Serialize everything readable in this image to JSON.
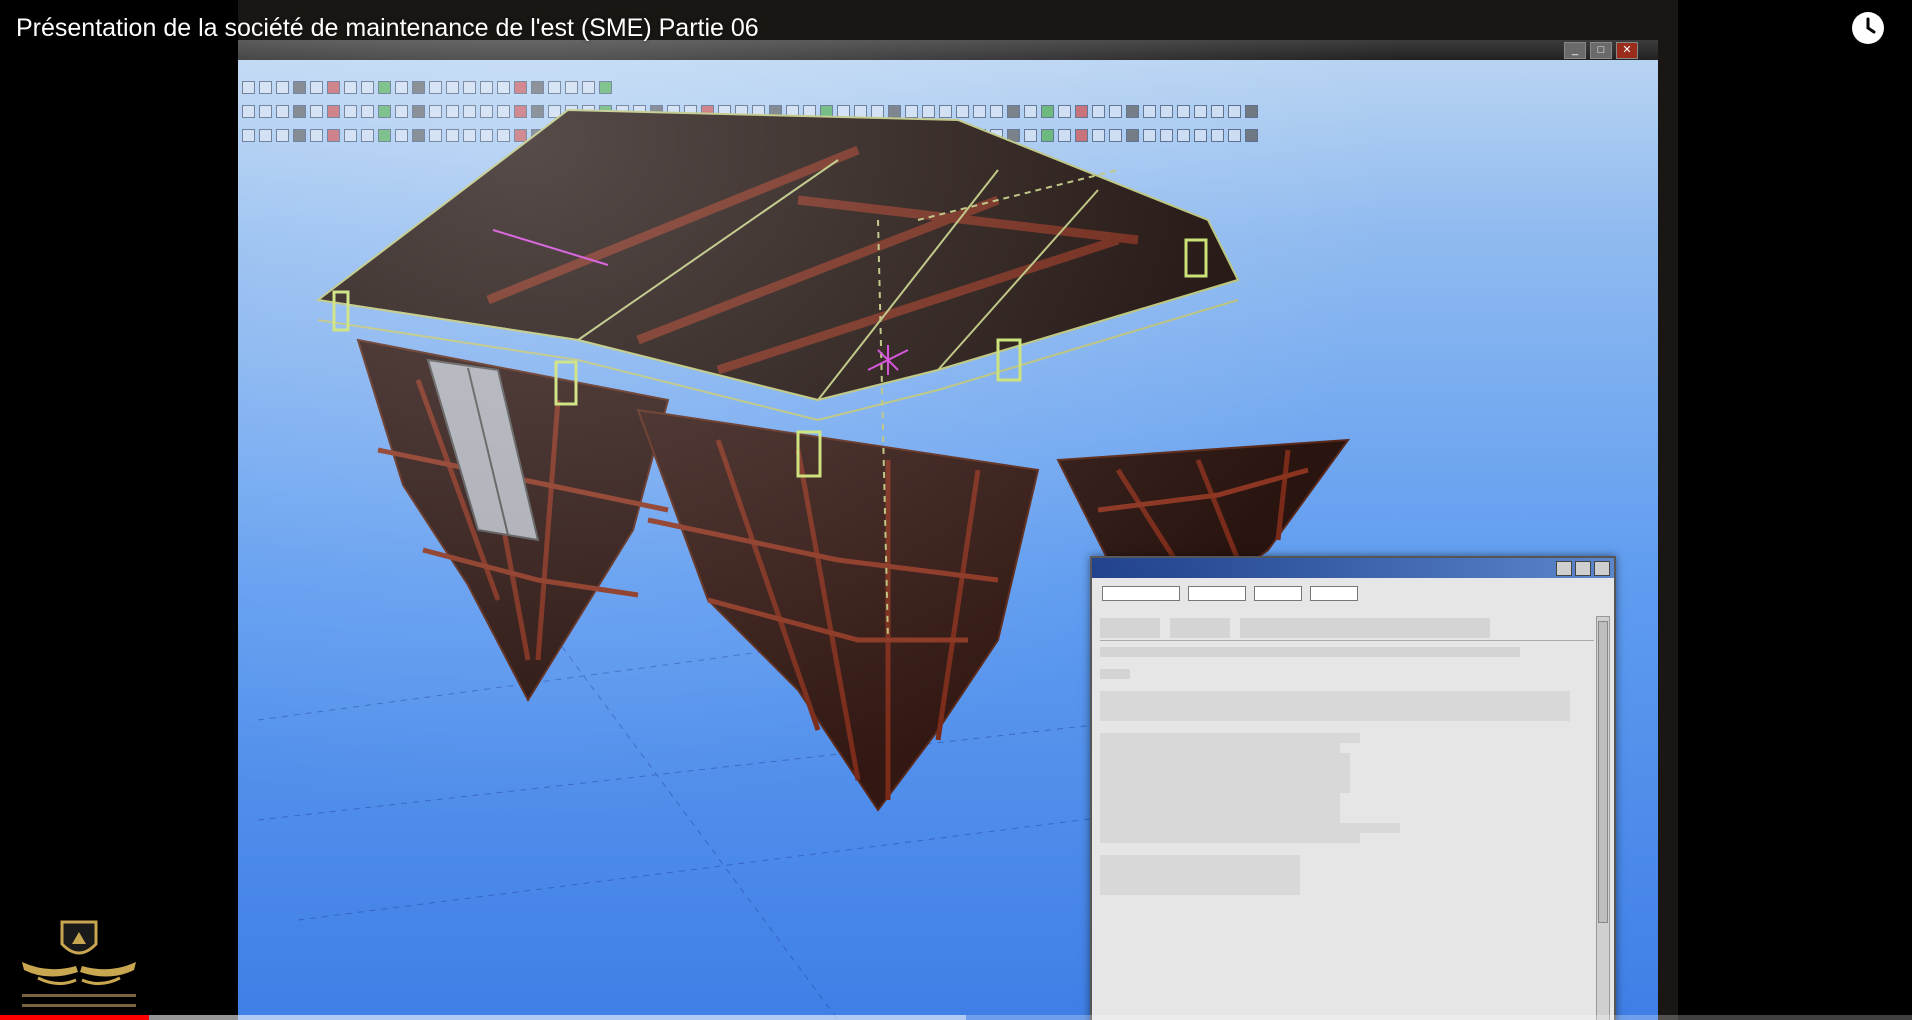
{
  "video": {
    "title": "Présentation de la société de maintenance de l'est (SME) Partie 06",
    "progress_fraction": 0.078,
    "buffered_fraction": 0.505
  },
  "icons": {
    "watch_later": "clock-icon",
    "channel_logo": "arab-defense-forum-logo"
  },
  "cad_window": {
    "min_label": "_",
    "max_label": "□",
    "close_label": "✕"
  },
  "colors": {
    "sky": "#5f9cf0",
    "model_dark": "#241410",
    "model_red": "#7a2a18",
    "highlight": "#c8e070",
    "progress": "#ff0000"
  }
}
